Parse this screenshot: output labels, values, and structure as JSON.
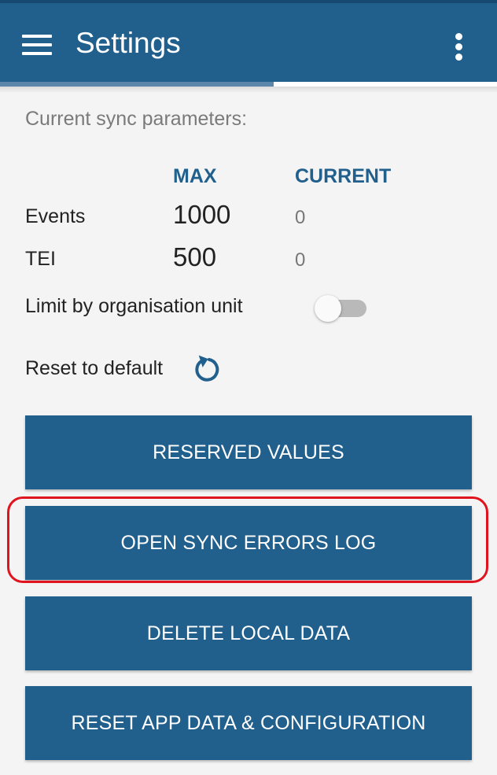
{
  "header": {
    "title": "Settings",
    "progress_fraction": 0.55
  },
  "sync": {
    "section_title": "Current sync parameters:",
    "col_max": "MAX",
    "col_current": "CURRENT",
    "rows": [
      {
        "label": "Events",
        "max": "1000",
        "current": "0"
      },
      {
        "label": "TEI",
        "max": "500",
        "current": "0"
      }
    ],
    "limit_label": "Limit by organisation unit",
    "limit_enabled": false,
    "reset_label": "Reset to default"
  },
  "buttons": {
    "reserved_values": "RESERVED VALUES",
    "open_sync_errors_log": "OPEN SYNC ERRORS LOG",
    "delete_local_data": "DELETE LOCAL DATA",
    "reset_app_data": "RESET APP DATA & CONFIGURATION"
  },
  "colors": {
    "primary": "#215f8d",
    "highlight": "#e0141e"
  },
  "icons": {
    "menu": "menu-icon",
    "more": "more-vert-icon",
    "reset": "reset-icon"
  }
}
